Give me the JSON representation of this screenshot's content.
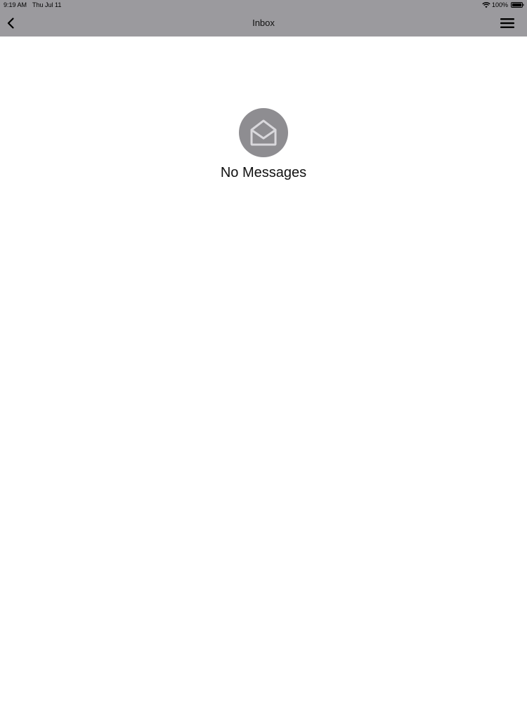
{
  "status_bar": {
    "time": "9:19 AM",
    "date": "Thu Jul 11",
    "battery_percent": "100%"
  },
  "nav": {
    "title": "Inbox",
    "back_icon": "chevron-left-icon",
    "menu_icon": "hamburger-menu-icon"
  },
  "empty_state": {
    "icon": "open-envelope-icon",
    "message": "No Messages"
  },
  "colors": {
    "header_bg": "#9b9a9e",
    "icon_circle": "#8e8d91",
    "page_bg": "#ffffff"
  }
}
